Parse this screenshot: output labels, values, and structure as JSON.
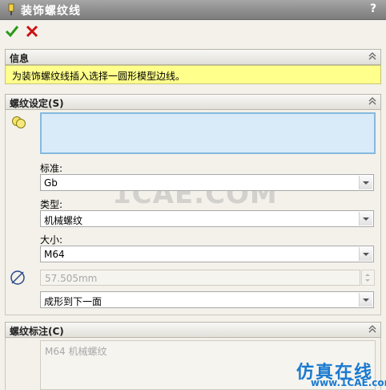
{
  "window": {
    "title": "装饰螺纹线",
    "help": "?"
  },
  "toolbar": {
    "ok_icon": "check-icon",
    "cancel_icon": "x-icon"
  },
  "info": {
    "header": "信息",
    "message": "为装饰螺纹线插入选择一圆形模型边线。"
  },
  "thread_settings": {
    "header": "螺纹设定(S)",
    "standard_label": "标准:",
    "standard_value": "Gb",
    "type_label": "类型:",
    "type_value": "机械螺纹",
    "size_label": "大小:",
    "size_value": "M64",
    "diameter_value": "57.505mm",
    "end_condition_value": "成形到下一面"
  },
  "thread_callout": {
    "header": "螺纹标注(C)",
    "text": "M64 机械螺纹"
  },
  "watermark": {
    "text": "1CAE.COM",
    "brand": "仿真在线",
    "url": "www.1CAE.com"
  },
  "colors": {
    "accent_check": "#2a9a1a",
    "cancel_red": "#cc1111",
    "info_bg": "#ffff8c",
    "selection_bg": "#d9ebf8"
  }
}
